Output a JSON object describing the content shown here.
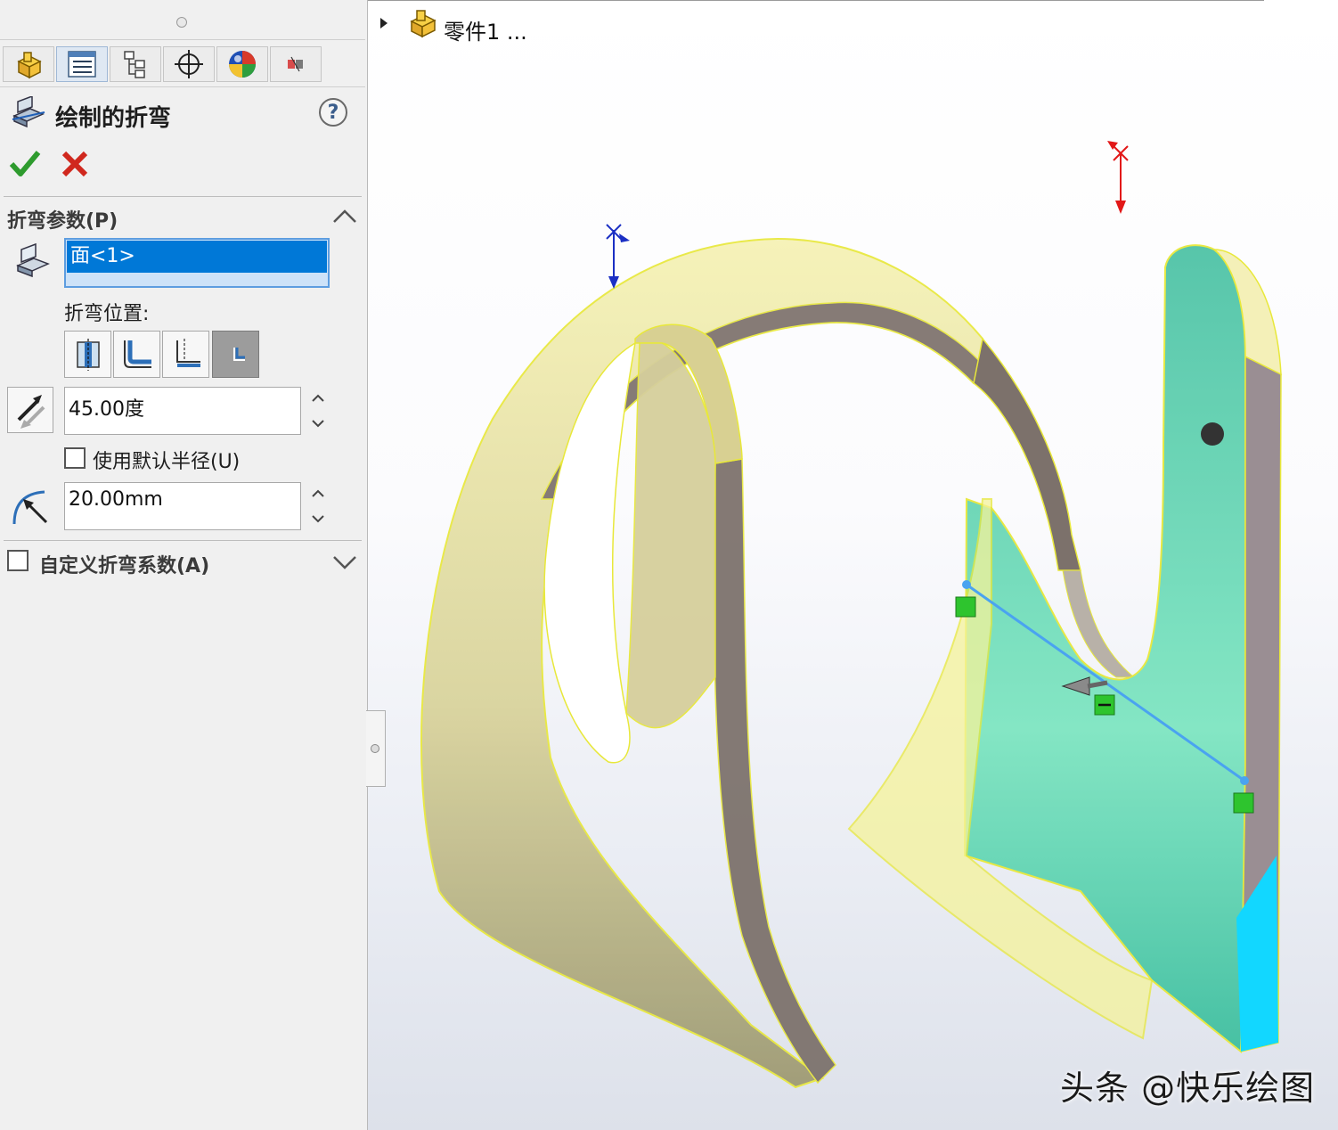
{
  "property_manager": {
    "title": "绘制的折弯",
    "help": "?",
    "tabs": [
      {
        "name": "feature-manager",
        "icon": "part-cube-icon"
      },
      {
        "name": "property-manager",
        "icon": "property-list-icon"
      },
      {
        "name": "configuration-manager",
        "icon": "configuration-tree-icon"
      },
      {
        "name": "dimxpert-manager",
        "icon": "crosshair-icon"
      },
      {
        "name": "display-manager",
        "icon": "color-sphere-icon"
      },
      {
        "name": "extra-tab",
        "icon": "small-tool-icon"
      }
    ],
    "bend_params": {
      "title": "折弯参数(P)",
      "selected_face": "面<1>",
      "bend_position_label": "折弯位置:",
      "bend_positions": [
        {
          "name": "bend-centerline",
          "selected": false
        },
        {
          "name": "material-inside",
          "selected": false
        },
        {
          "name": "material-outside",
          "selected": false
        },
        {
          "name": "bend-outside",
          "selected": true
        }
      ],
      "angle": "45.00度",
      "use_default_radius_label": "使用默认半径(U)",
      "use_default_radius_checked": false,
      "radius": "20.00mm"
    },
    "custom_bend_allowance": {
      "title": "自定义折弯系数(A)",
      "checked": false
    }
  },
  "viewport": {
    "part_name": "零件1 ...",
    "watermark": "头条 @快乐绘图"
  },
  "colors": {
    "accent": "#0078d7",
    "ok": "#2e9b2e",
    "cancel": "#d0281e",
    "highlight_yellow": "#f1f05a",
    "face_teal": "#5fd4b0",
    "edge_gray": "#7a6f69"
  }
}
